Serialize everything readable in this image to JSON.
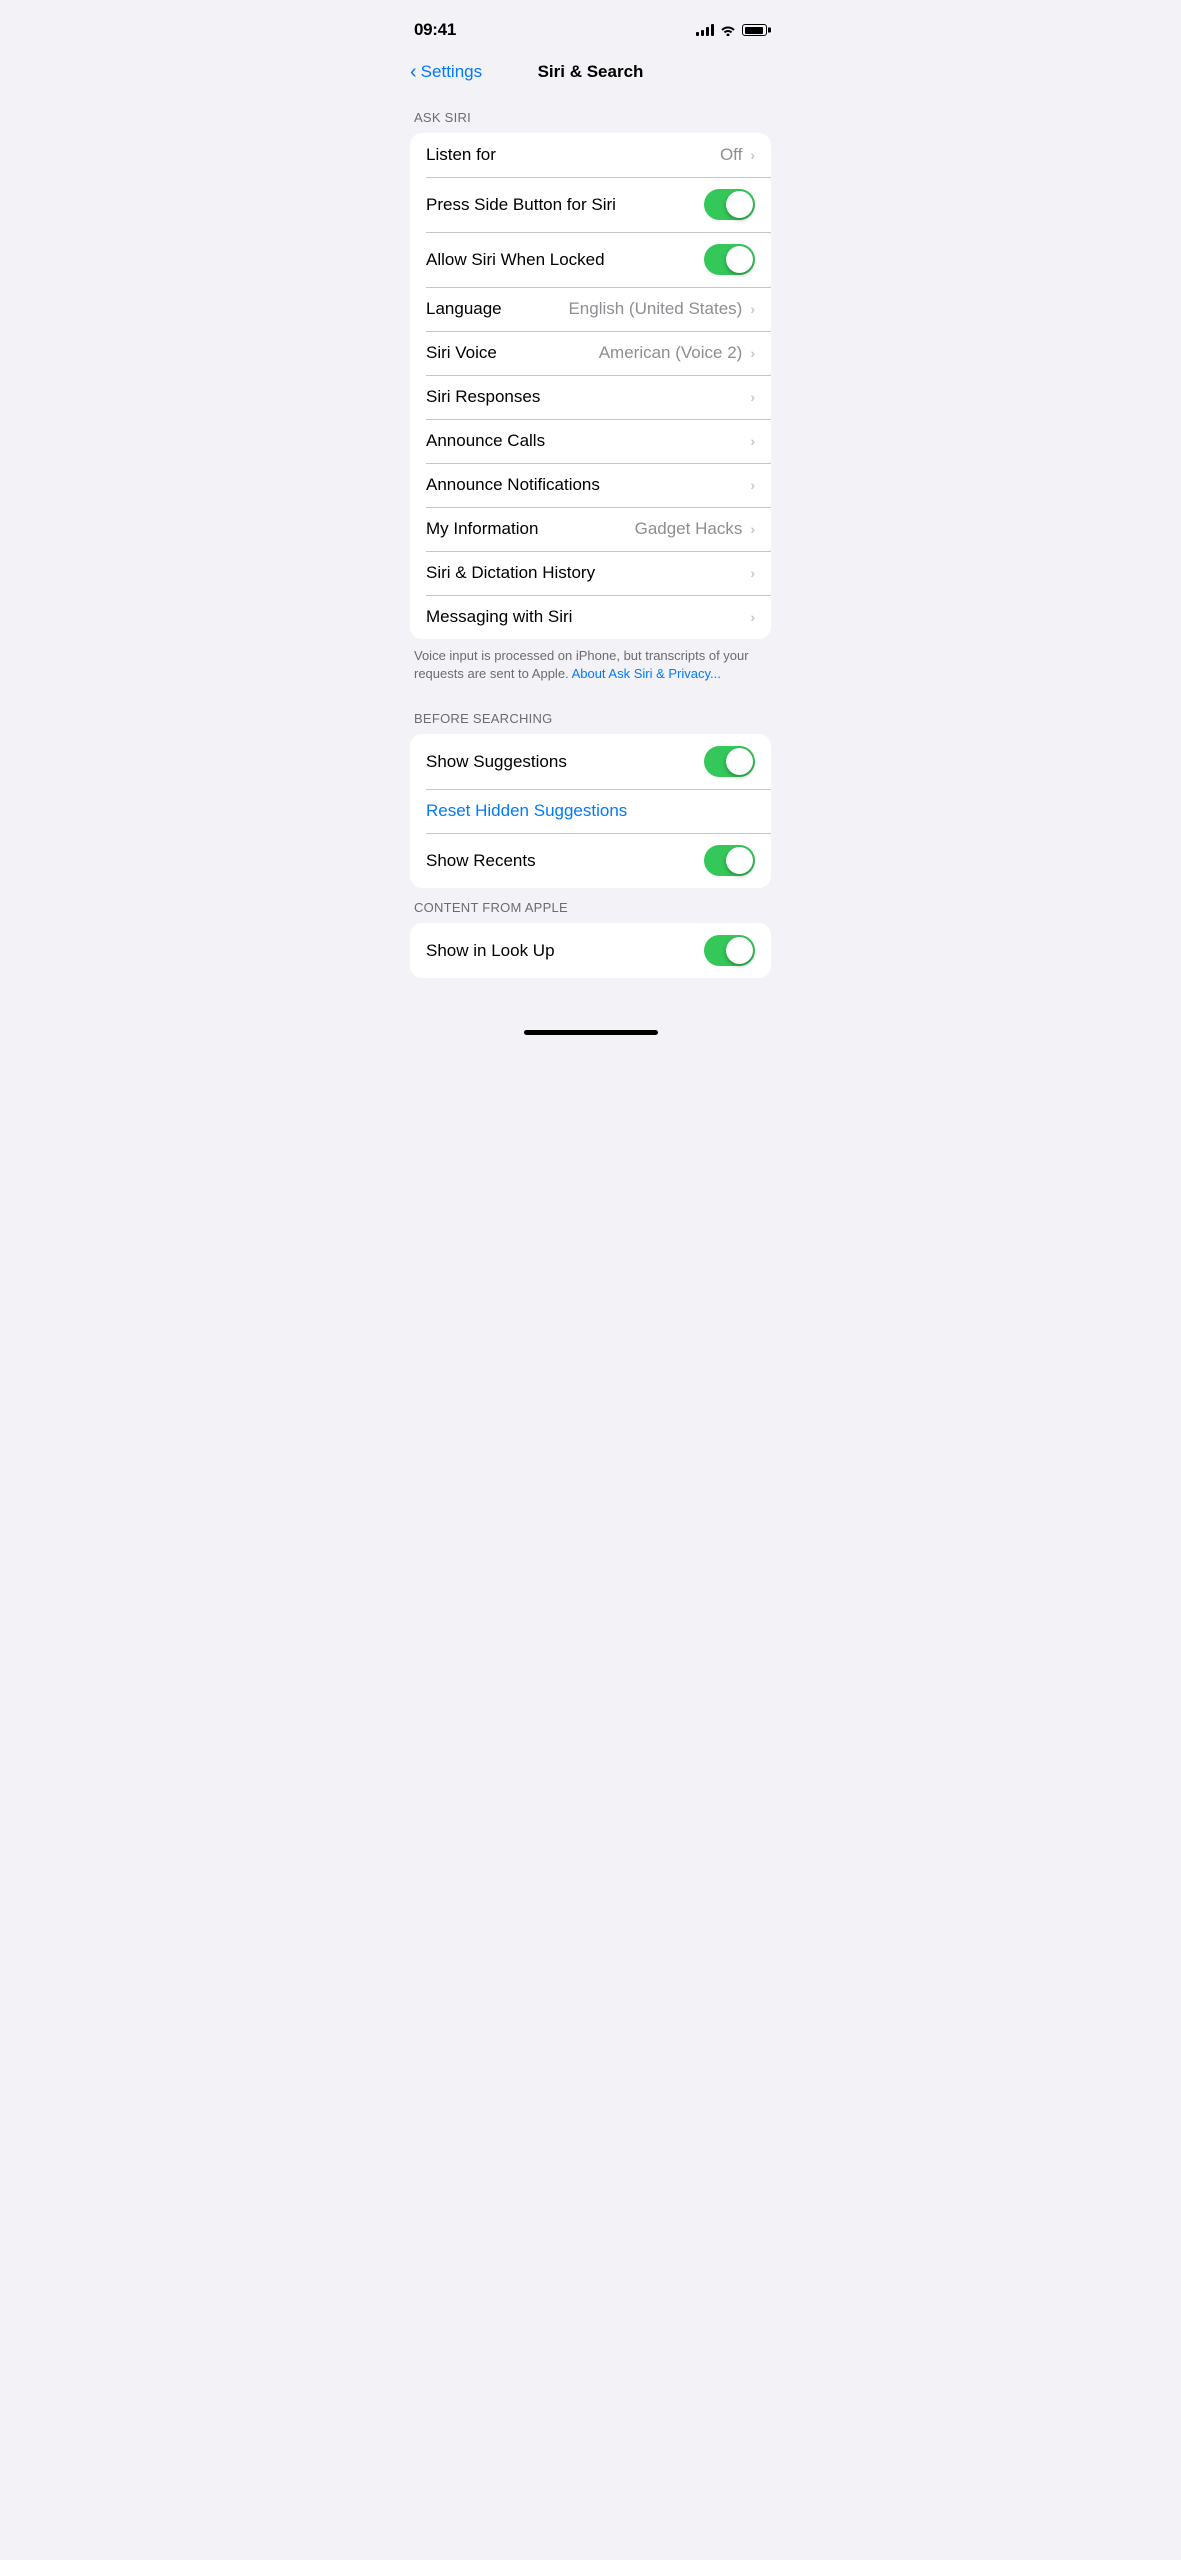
{
  "statusBar": {
    "time": "09:41"
  },
  "header": {
    "backLabel": "Settings",
    "title": "Siri & Search"
  },
  "sections": [
    {
      "id": "ask-siri",
      "label": "ASK SIRI",
      "rows": [
        {
          "id": "listen-for",
          "label": "Listen for",
          "valueText": "Off",
          "type": "chevron"
        },
        {
          "id": "press-side-button",
          "label": "Press Side Button for Siri",
          "type": "toggle",
          "toggleOn": true
        },
        {
          "id": "allow-when-locked",
          "label": "Allow Siri When Locked",
          "type": "toggle",
          "toggleOn": true
        },
        {
          "id": "language",
          "label": "Language",
          "valueText": "English (United States)",
          "type": "chevron"
        },
        {
          "id": "siri-voice",
          "label": "Siri Voice",
          "valueText": "American (Voice 2)",
          "type": "chevron"
        },
        {
          "id": "siri-responses",
          "label": "Siri Responses",
          "type": "chevron-only"
        },
        {
          "id": "announce-calls",
          "label": "Announce Calls",
          "type": "chevron-only"
        },
        {
          "id": "announce-notifications",
          "label": "Announce Notifications",
          "type": "chevron-only"
        },
        {
          "id": "my-information",
          "label": "My Information",
          "valueText": "Gadget Hacks",
          "type": "chevron"
        },
        {
          "id": "siri-dictation-history",
          "label": "Siri & Dictation History",
          "type": "chevron-only"
        },
        {
          "id": "messaging-with-siri",
          "label": "Messaging with Siri",
          "type": "chevron-only"
        }
      ],
      "footer": "Voice input is processed on iPhone, but transcripts of your requests are sent to Apple.",
      "footerLink": "About Ask Siri & Privacy...",
      "footerLinkUrl": "#"
    },
    {
      "id": "before-searching",
      "label": "BEFORE SEARCHING",
      "rows": [
        {
          "id": "show-suggestions",
          "label": "Show Suggestions",
          "type": "toggle",
          "toggleOn": true
        },
        {
          "id": "reset-hidden-suggestions",
          "label": "Reset Hidden Suggestions",
          "type": "link"
        },
        {
          "id": "show-recents",
          "label": "Show Recents",
          "type": "toggle",
          "toggleOn": true
        }
      ],
      "footer": null
    },
    {
      "id": "content-from-apple",
      "label": "CONTENT FROM APPLE",
      "rows": [
        {
          "id": "show-in-look-up",
          "label": "Show in Look Up",
          "type": "toggle",
          "toggleOn": true
        }
      ],
      "footer": null
    }
  ],
  "homeIndicator": true
}
